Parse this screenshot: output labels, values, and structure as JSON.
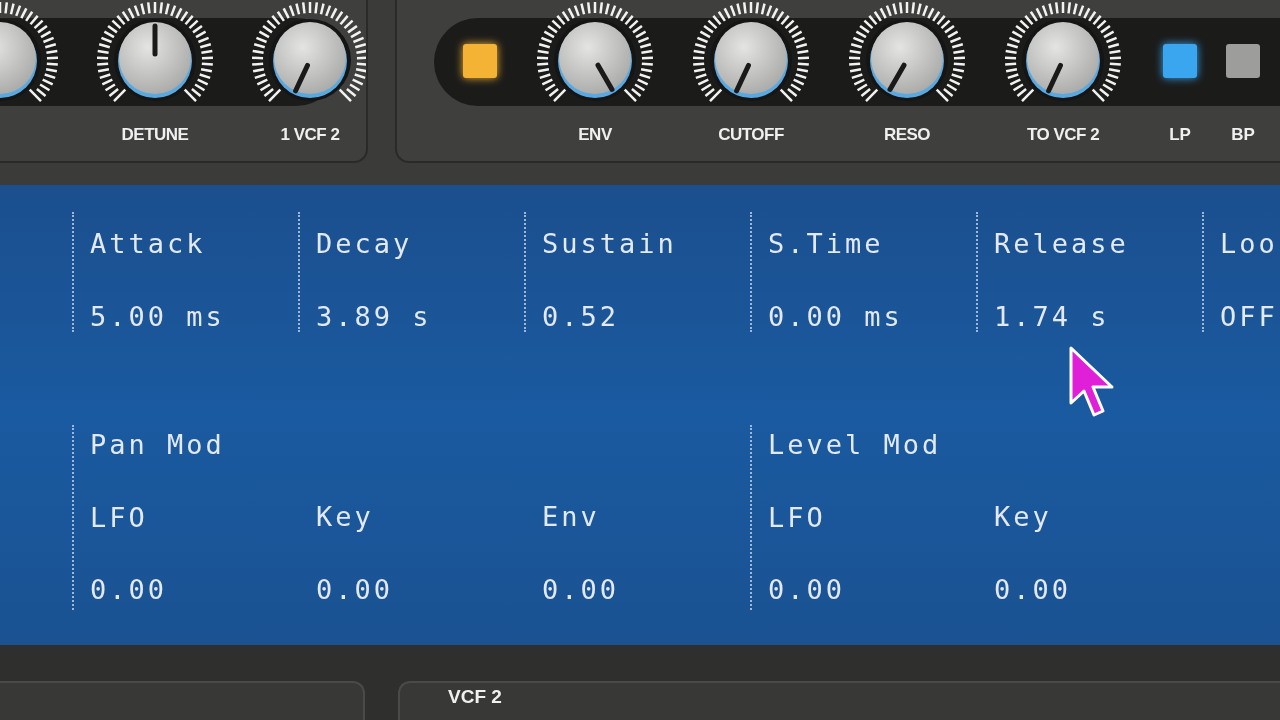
{
  "osc_panel": {
    "knobs": [
      {
        "label": "DETUNE"
      },
      {
        "label": "1 VCF 2"
      }
    ]
  },
  "vcf_panel": {
    "switch": {
      "on": true,
      "color": "#f5b335"
    },
    "knobs": [
      {
        "label": "ENV"
      },
      {
        "label": "CUTOFF"
      },
      {
        "label": "RESO"
      },
      {
        "label": "TO VCF 2"
      }
    ],
    "modes": [
      {
        "label": "LP",
        "selected": true
      },
      {
        "label": "BP",
        "selected": false
      }
    ]
  },
  "envelope": [
    {
      "label": "Attack",
      "value": "5.00 ms"
    },
    {
      "label": "Decay",
      "value": "3.89 s"
    },
    {
      "label": "Sustain",
      "value": "0.52"
    },
    {
      "label": "S.Time",
      "value": "0.00 ms"
    },
    {
      "label": "Release",
      "value": "1.74 s"
    },
    {
      "label": "Loo",
      "value": "OFF"
    }
  ],
  "pan_mod": {
    "title": "Pan Mod",
    "params": [
      {
        "label": "LFO",
        "value": "0.00"
      },
      {
        "label": "Key",
        "value": "0.00"
      },
      {
        "label": "Env",
        "value": "0.00"
      }
    ]
  },
  "level_mod": {
    "title": "Level Mod",
    "params": [
      {
        "label": "LFO",
        "value": "0.00"
      },
      {
        "label": "Key",
        "value": "0.00"
      }
    ]
  },
  "bottom_panel": {
    "title": "VCF 2"
  }
}
